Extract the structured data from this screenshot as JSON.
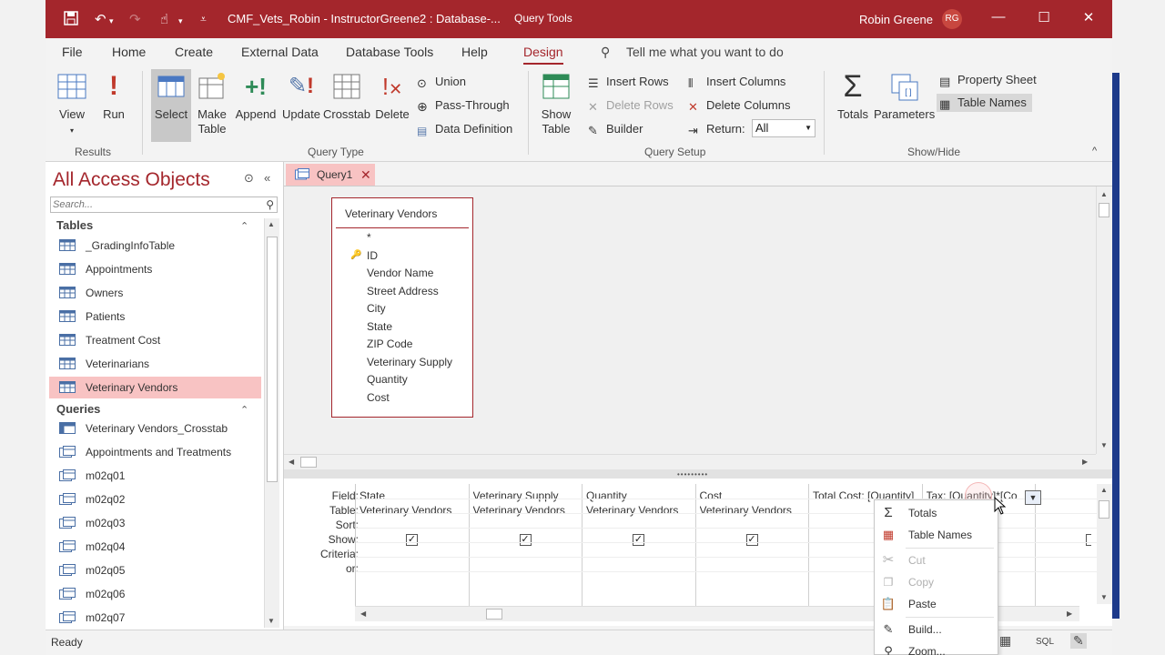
{
  "titlebar": {
    "title": "CMF_Vets_Robin - InstructorGreene2 : Database-...",
    "context_tools": "Query Tools",
    "user": "Robin Greene",
    "initials": "RG"
  },
  "menu": {
    "tabs": [
      "File",
      "Home",
      "Create",
      "External Data",
      "Database Tools",
      "Help",
      "Design"
    ],
    "active": "Design",
    "tell_me": "Tell me what you want to do"
  },
  "ribbon": {
    "results": {
      "label": "Results",
      "view": "View",
      "run": "Run"
    },
    "query_type": {
      "label": "Query Type",
      "select": "Select",
      "make_table": "Make Table",
      "append": "Append",
      "update": "Update",
      "crosstab": "Crosstab",
      "delete": "Delete",
      "union": "Union",
      "pass_through": "Pass-Through",
      "data_definition": "Data Definition"
    },
    "query_setup": {
      "label": "Query Setup",
      "show_table": "Show Table",
      "insert_rows": "Insert Rows",
      "delete_rows": "Delete Rows",
      "builder": "Builder",
      "insert_columns": "Insert Columns",
      "delete_columns": "Delete Columns",
      "return_label": "Return:",
      "return_value": "All"
    },
    "show_hide": {
      "label": "Show/Hide",
      "totals": "Totals",
      "parameters": "Parameters",
      "property_sheet": "Property Sheet",
      "table_names": "Table Names"
    }
  },
  "nav": {
    "title": "All Access Objects",
    "search_placeholder": "Search...",
    "tables_label": "Tables",
    "tables": [
      "_GradingInfoTable",
      "Appointments",
      "Owners",
      "Patients",
      "Treatment Cost",
      "Veterinarians",
      "Veterinary Vendors"
    ],
    "selected_table": "Veterinary Vendors",
    "queries_label": "Queries",
    "queries": [
      "Veterinary Vendors_Crosstab",
      "Appointments and Treatments",
      "m02q01",
      "m02q02",
      "m02q03",
      "m02q04",
      "m02q05",
      "m02q06",
      "m02q07"
    ]
  },
  "query_tab": {
    "label": "Query1"
  },
  "table_box": {
    "title": "Veterinary Vendors",
    "fields": [
      "*",
      "ID",
      "Vendor Name",
      "Street Address",
      "City",
      "State",
      "ZIP Code",
      "Veterinary Supply",
      "Quantity",
      "Cost"
    ]
  },
  "grid": {
    "row_labels": [
      "Field:",
      "Table:",
      "Sort:",
      "Show:",
      "Criteria:",
      "or:"
    ],
    "columns": [
      {
        "field": "State",
        "table": "Veterinary Vendors"
      },
      {
        "field": "Veterinary Supply",
        "table": "Veterinary Vendors"
      },
      {
        "field": "Quantity",
        "table": "Veterinary Vendors"
      },
      {
        "field": "Cost",
        "table": "Veterinary Vendors"
      },
      {
        "field": "Total Cost: [Quantity]",
        "table": ""
      },
      {
        "field": "Tax: [Quantity]*[Co",
        "table": ""
      }
    ]
  },
  "context_menu": {
    "items": [
      "Totals",
      "Table Names",
      "Cut",
      "Copy",
      "Paste",
      "Build...",
      "Zoom..."
    ]
  },
  "status": {
    "text": "Ready",
    "sql": "SQL"
  },
  "colors": {
    "accent": "#a4262c",
    "selection": "#f8c3c3"
  }
}
